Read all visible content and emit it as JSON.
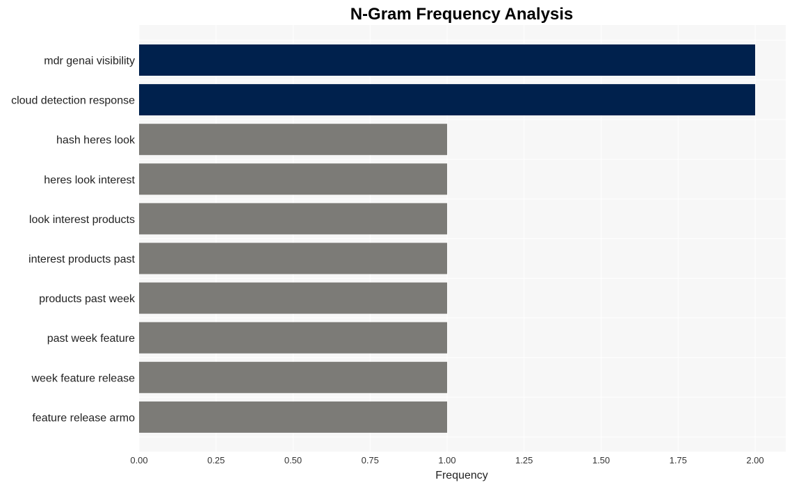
{
  "chart_data": {
    "type": "bar",
    "orientation": "horizontal",
    "title": "N-Gram Frequency Analysis",
    "xlabel": "Frequency",
    "ylabel": "",
    "categories": [
      "mdr genai visibility",
      "cloud detection response",
      "hash heres look",
      "heres look interest",
      "look interest products",
      "interest products past",
      "products past week",
      "past week feature",
      "week feature release",
      "feature release armo"
    ],
    "values": [
      2,
      2,
      1,
      1,
      1,
      1,
      1,
      1,
      1,
      1
    ],
    "bar_colors": [
      "#00214d",
      "#00214d",
      "#7c7b77",
      "#7c7b77",
      "#7c7b77",
      "#7c7b77",
      "#7c7b77",
      "#7c7b77",
      "#7c7b77",
      "#7c7b77"
    ],
    "xlim": [
      0,
      2.1
    ],
    "xticks": [
      0,
      0.25,
      0.5,
      0.75,
      1.0,
      1.25,
      1.5,
      1.75,
      2.0
    ],
    "xtick_labels": [
      "0.00",
      "0.25",
      "0.50",
      "0.75",
      "1.00",
      "1.25",
      "1.50",
      "1.75",
      "2.00"
    ],
    "grid": true,
    "legend": "none",
    "background_color": "#f7f7f7"
  }
}
